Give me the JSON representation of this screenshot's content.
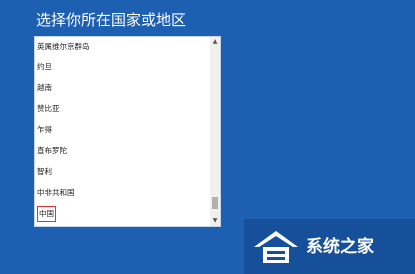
{
  "title": "选择你所在国家或地区",
  "regions": [
    "英属维尔京群岛",
    "约旦",
    "越南",
    "赞比亚",
    "乍得",
    "直布罗陀",
    "智利",
    "中非共和国",
    "中国"
  ],
  "selected_region": "中国",
  "scrollbar": {
    "up_glyph": "▲",
    "down_glyph": "▼"
  },
  "watermark": {
    "text": "系统之家"
  },
  "colors": {
    "background": "#1d5fb0",
    "selection_border": "#e0303a"
  }
}
